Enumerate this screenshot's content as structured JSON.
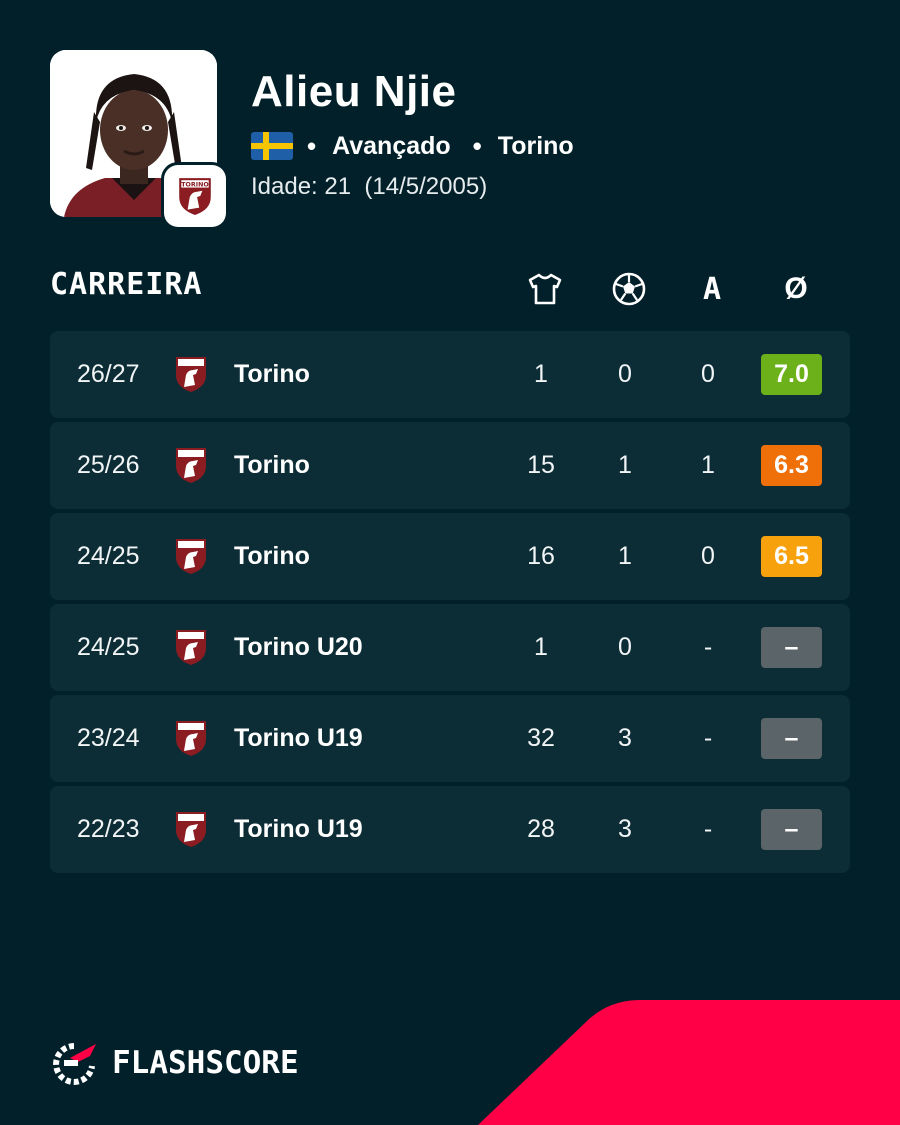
{
  "player": {
    "name": "Alieu Njie",
    "position": "Avançado",
    "club": "Torino",
    "age_label": "Idade: 21  (14/5/2005)"
  },
  "meta": {
    "bullet": "•"
  },
  "career": {
    "title": "CARREIRA",
    "columns": {
      "apps_icon": "shirt-icon",
      "goals_icon": "ball-icon",
      "assists": "A",
      "rating": "Ø"
    },
    "rows": [
      {
        "season": "26/27",
        "team": "Torino",
        "apps": "1",
        "goals": "0",
        "assists": "0",
        "rating": "7.0",
        "rating_color": "#6cb11a"
      },
      {
        "season": "25/26",
        "team": "Torino",
        "apps": "15",
        "goals": "1",
        "assists": "1",
        "rating": "6.3",
        "rating_color": "#ef7008"
      },
      {
        "season": "24/25",
        "team": "Torino",
        "apps": "16",
        "goals": "1",
        "assists": "0",
        "rating": "6.5",
        "rating_color": "#f7a20c"
      },
      {
        "season": "24/25",
        "team": "Torino U20",
        "apps": "1",
        "goals": "0",
        "assists": "-",
        "rating": "–",
        "rating_color": "#5b6468"
      },
      {
        "season": "23/24",
        "team": "Torino U19",
        "apps": "32",
        "goals": "3",
        "assists": "-",
        "rating": "–",
        "rating_color": "#5b6468"
      },
      {
        "season": "22/23",
        "team": "Torino U19",
        "apps": "28",
        "goals": "3",
        "assists": "-",
        "rating": "–",
        "rating_color": "#5b6468"
      }
    ]
  },
  "brand": {
    "name": "FLASHSCORE",
    "accent": "#ff0046"
  },
  "colors": {
    "background": "#022029",
    "row": "#0c2d36",
    "crest": "#8a1c22"
  }
}
